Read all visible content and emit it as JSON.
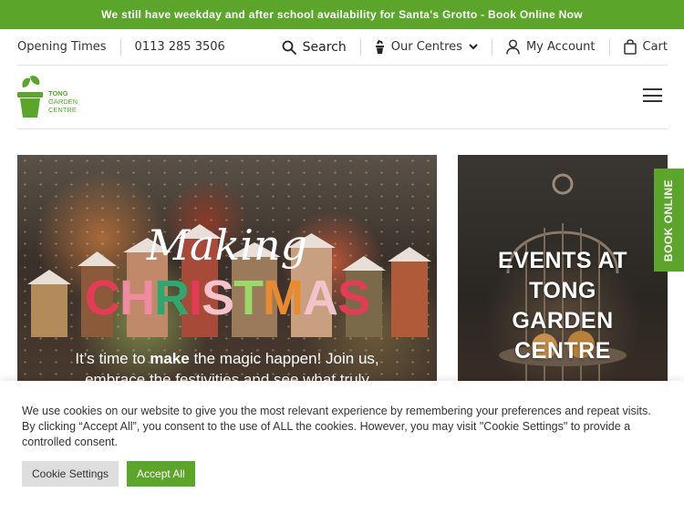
{
  "promo": {
    "text": "We still have weekday and after school availability for Santa's Grotto - Book Online Now"
  },
  "utility": {
    "opening_times": "Opening Times",
    "phone": "0113 285 3506",
    "search_label": "Search",
    "centres_label": "Our Centres",
    "account_label": "My Account",
    "cart_label": "Cart"
  },
  "logo": {
    "line1": "TONG",
    "line2": "GARDEN",
    "line3": "CENTRE",
    "color": "#5aa52a"
  },
  "hero": {
    "script_title": "Making",
    "big_title_letters": [
      "C",
      "H",
      "R",
      "I",
      "S",
      "T",
      "M",
      "A",
      "S"
    ],
    "tagline_pre": "It’s time to ",
    "tagline_bold": "make",
    "tagline_post": " the magic happen! Join us, embrace the festivities and see what truly"
  },
  "events_card": {
    "line1": "EVENTS AT",
    "line2": "TONG",
    "line3": "GARDEN",
    "line4": "CENTRE"
  },
  "side_tab": {
    "label": "BOOK ONLINE"
  },
  "cookie_banner": {
    "message": "We use cookies on our website to give you the most relevant experience by remembering your preferences and repeat visits. By clicking “Accept All”, you consent to the use of ALL the cookies. However, you may visit \"Cookie Settings\" to provide a controlled consent.",
    "settings_label": "Cookie Settings",
    "accept_label": "Accept All"
  },
  "colors": {
    "brand_green": "#5aa52a",
    "button_grey": "#dedede"
  }
}
